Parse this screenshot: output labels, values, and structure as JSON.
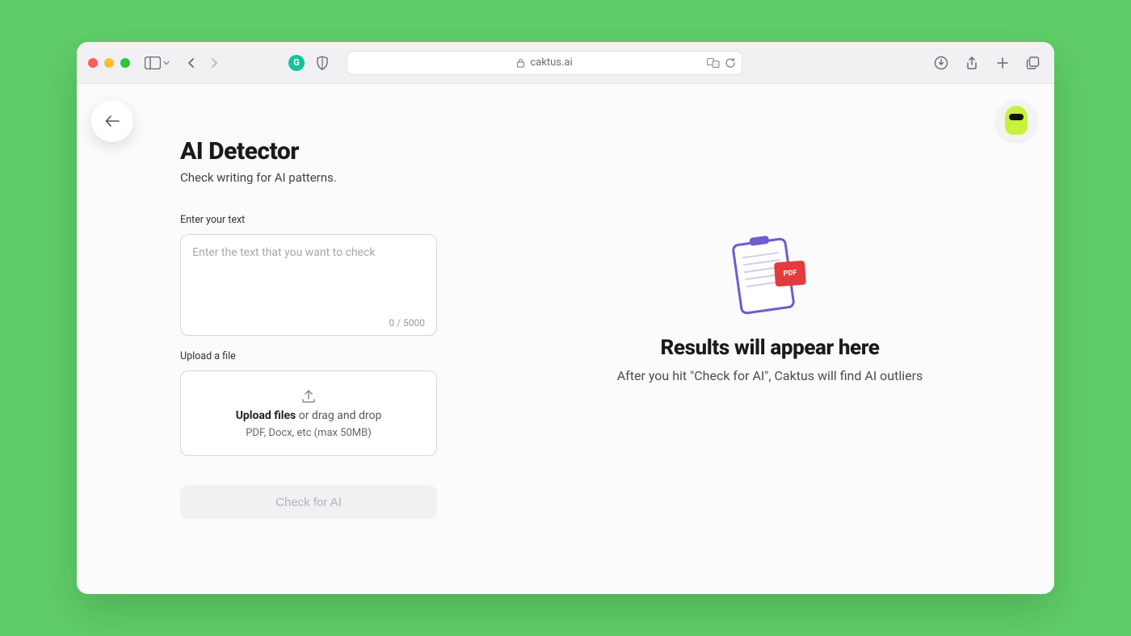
{
  "browser": {
    "url_host": "caktus.ai"
  },
  "page": {
    "title": "AI Detector",
    "subtitle": "Check writing for AI patterns."
  },
  "text_input": {
    "label": "Enter your text",
    "placeholder": "Enter the text that you want to check",
    "char_count": "0 / 5000"
  },
  "upload": {
    "label": "Upload a file",
    "cta_bold": "Upload files",
    "cta_rest": " or drag and drop",
    "hint": "PDF, Docx, etc (max 50MB)"
  },
  "action": {
    "check_button": "Check for AI"
  },
  "results": {
    "title": "Results will appear here",
    "subtitle": "After you hit \"Check for AI\", Caktus will find AI outliers",
    "pdf_badge": "PDF"
  }
}
